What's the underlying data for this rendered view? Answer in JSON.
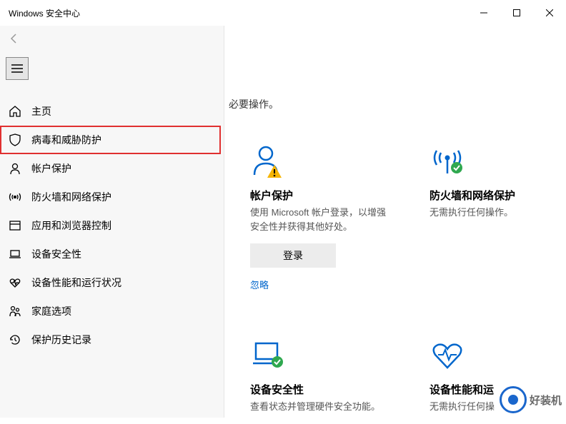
{
  "titlebar": {
    "title": "Windows 安全中心"
  },
  "nav": {
    "items": [
      {
        "label": "主页"
      },
      {
        "label": "病毒和威胁防护"
      },
      {
        "label": "帐户保护"
      },
      {
        "label": "防火墙和网络保护"
      },
      {
        "label": "应用和浏览器控制"
      },
      {
        "label": "设备安全性"
      },
      {
        "label": "设备性能和运行状况"
      },
      {
        "label": "家庭选项"
      },
      {
        "label": "保护历史记录"
      }
    ]
  },
  "main": {
    "hint_fragment": "必要操作。",
    "cards_row1": [
      {
        "title": "帐户保护",
        "desc": "使用 Microsoft 帐户登录，以增强安全性并获得其他好处。",
        "button": "登录",
        "link": "忽略"
      },
      {
        "title": "防火墙和网络保护",
        "desc": "无需执行任何操作。"
      }
    ],
    "cards_row2": [
      {
        "title": "设备安全性",
        "desc": "查看状态并管理硬件安全功能。"
      },
      {
        "title_fragment": "设备性能和运",
        "desc_fragment": "无需执行任何操"
      }
    ]
  },
  "watermark": {
    "text": "好装机"
  }
}
